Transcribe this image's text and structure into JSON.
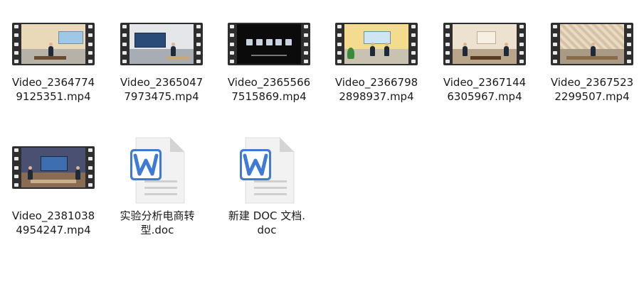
{
  "files": [
    {
      "line1": "Video_2364774",
      "line2": "9125351.mp4",
      "icon": "video-thumbnail",
      "scene": "office-window"
    },
    {
      "line1": "Video_2365047",
      "line2": "7973475.mp4",
      "icon": "video-thumbnail",
      "scene": "blue-screen-hall"
    },
    {
      "line1": "Video_2365566",
      "line2": "7515869.mp4",
      "icon": "video-thumbnail",
      "scene": "dark-menu"
    },
    {
      "line1": "Video_2366798",
      "line2": "2898937.mp4",
      "icon": "video-thumbnail",
      "scene": "yellow-office"
    },
    {
      "line1": "Video_2367144",
      "line2": "6305967.mp4",
      "icon": "video-thumbnail",
      "scene": "meeting-room"
    },
    {
      "line1": "Video_2367523",
      "line2": "2299507.mp4",
      "icon": "video-thumbnail",
      "scene": "patterned-wall"
    },
    {
      "line1": "Video_2381038",
      "line2": "4954247.mp4",
      "icon": "video-thumbnail",
      "scene": "conference-hall"
    },
    {
      "line1": "实验分析电商转",
      "line2": "型.doc",
      "icon": "wps-word-doc-icon"
    },
    {
      "line1": "新建 DOC 文档.",
      "line2": "doc",
      "icon": "wps-word-doc-icon"
    }
  ],
  "colors": {
    "film": "#2e2e2e",
    "doc_blue": "#3e7bd6",
    "doc_paper": "#f2f2f2",
    "doc_fold": "#d4d4d4"
  }
}
